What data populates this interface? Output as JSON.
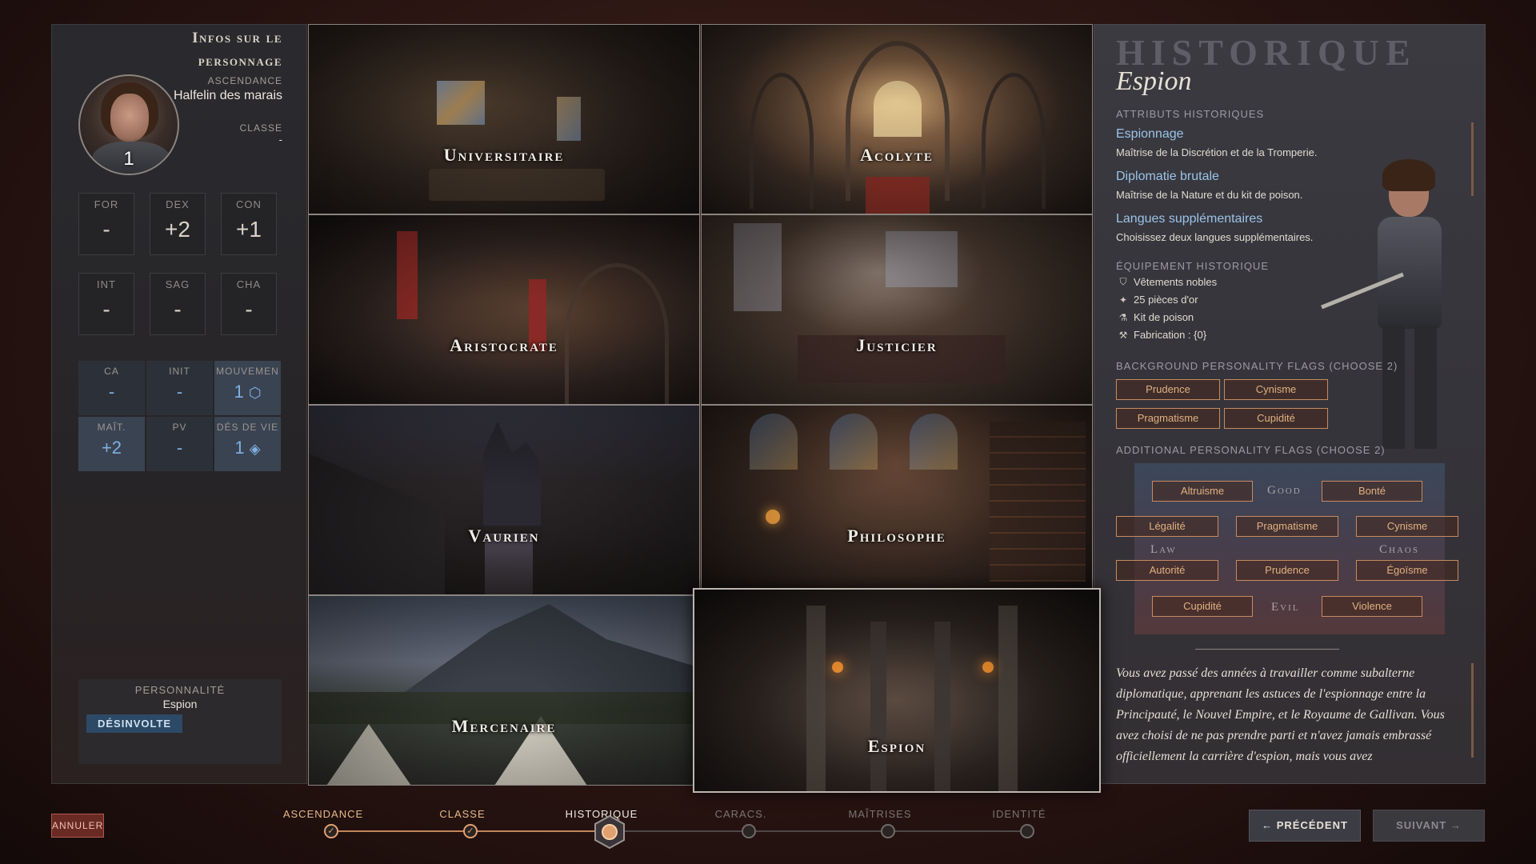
{
  "character": {
    "panel_title_line1": "Infos sur le",
    "panel_title_line2": "personnage",
    "ascendance_label": "ASCENDANCE",
    "ascendance_value": "Halfelin des marais",
    "classe_label": "CLASSE",
    "classe_value": "-",
    "level": "1"
  },
  "abilities": [
    {
      "label": "FOR",
      "value": "-"
    },
    {
      "label": "DEX",
      "value": "+2"
    },
    {
      "label": "CON",
      "value": "+1"
    },
    {
      "label": "INT",
      "value": "-"
    },
    {
      "label": "SAG",
      "value": "-"
    },
    {
      "label": "CHA",
      "value": "-"
    }
  ],
  "combat": [
    {
      "label": "CA",
      "value": "-"
    },
    {
      "label": "INIT",
      "value": "-"
    },
    {
      "label": "MOUVEMEN",
      "value": "1"
    },
    {
      "label": "MAÎT.",
      "value": "+2"
    },
    {
      "label": "PV",
      "value": "-"
    },
    {
      "label": "DÉS DE VIE",
      "value": "1"
    }
  ],
  "personality": {
    "label": "PERSONNALITÉ",
    "value": "Espion",
    "badge": "DÉSINVOLTE"
  },
  "backgrounds": [
    {
      "name": "Universitaire"
    },
    {
      "name": "Acolyte"
    },
    {
      "name": "Aristocrate"
    },
    {
      "name": "Justicier"
    },
    {
      "name": "Vaurien"
    },
    {
      "name": "Philosophe"
    },
    {
      "name": "Mercenaire"
    },
    {
      "name": "Espion"
    }
  ],
  "historique": {
    "title": "HISTORIQUE",
    "subtitle": "Espion",
    "attributes_header": "ATTRIBUTS HISTORIQUES",
    "features": [
      {
        "title": "Espionnage",
        "desc": "Maîtrise de la Discrétion et de la Tromperie."
      },
      {
        "title": "Diplomatie brutale",
        "desc": "Maîtrise de la Nature et du kit de poison."
      },
      {
        "title": "Langues supplémentaires",
        "desc": "Choisissez deux langues supplémentaires."
      }
    ],
    "equipment_header": "ÉQUIPEMENT HISTORIQUE",
    "equipment": [
      {
        "icon": "shield-icon",
        "text": "Vêtements nobles"
      },
      {
        "icon": "coin-icon",
        "text": "25 pièces d'or"
      },
      {
        "icon": "kit-icon",
        "text": "Kit de poison"
      },
      {
        "icon": "craft-icon",
        "text": "Fabrication : {0}"
      }
    ],
    "bg_flags_header": "BACKGROUND PERSONALITY FLAGS (CHOOSE 2)",
    "bg_flags": [
      "Prudence",
      "Cynisme",
      "Pragmatisme",
      "Cupidité"
    ],
    "add_flags_header": "ADDITIONAL PERSONALITY FLAGS (CHOOSE 2)",
    "alignment": {
      "good": "Good",
      "law": "Law",
      "chaos": "Chaos",
      "evil": "Evil",
      "flags": [
        "Altruisme",
        "Bonté",
        "Légalité",
        "Pragmatisme",
        "Cynisme",
        "Autorité",
        "Prudence",
        "Égoïsme",
        "Cupidité",
        "Violence"
      ]
    },
    "description": "Vous avez passé des années à travailler comme subalterne diplomatique, apprenant les astuces de l'espionnage entre la Principauté, le Nouvel Empire, et le Royaume de Gallivan. Vous avez choisi de ne pas prendre parti et n'avez jamais embrassé officiellement la carrière d'espion, mais vous avez"
  },
  "footer": {
    "cancel": "ANNULER",
    "steps": [
      "ASCENDANCE",
      "CLASSE",
      "HISTORIQUE",
      "CARACS.",
      "MAÎTRISES",
      "IDENTITÉ"
    ],
    "current_step": 2,
    "prev": "PRÉCÉDENT",
    "next": "SUIVANT"
  },
  "colors": {
    "accent": "#c2865a",
    "link_blue": "#9cc3e8",
    "flag_border": "#c68a62"
  }
}
